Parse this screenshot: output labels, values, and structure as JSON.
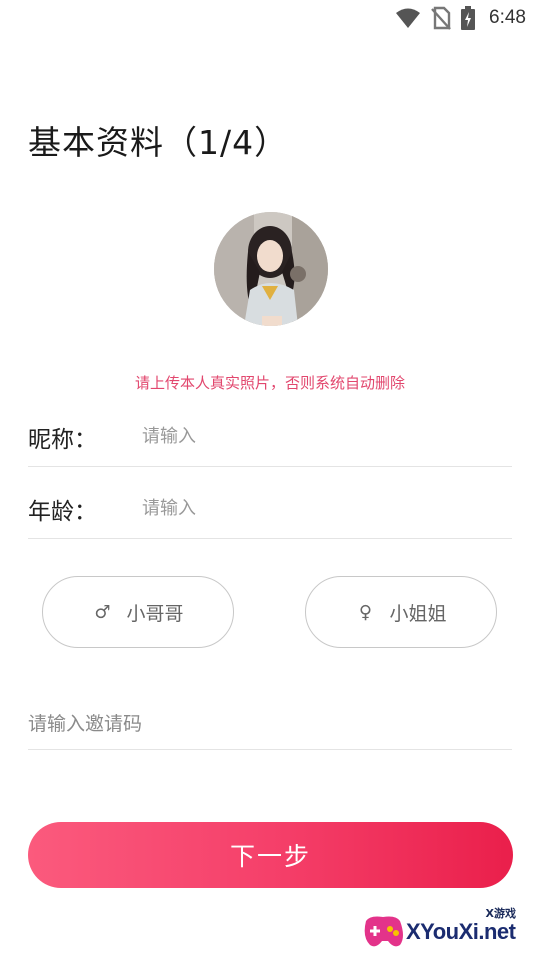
{
  "status_bar": {
    "time": "6:48",
    "icons": [
      "wifi-icon",
      "no-sim-icon",
      "battery-charging-icon"
    ]
  },
  "title": "基本资料（1/4）",
  "avatar": {
    "hint": "请上传本人真实照片，否则系统自动删除"
  },
  "form": {
    "nickname": {
      "label": "昵称：",
      "placeholder": "请输入",
      "value": ""
    },
    "age": {
      "label": "年龄：",
      "placeholder": "请输入",
      "value": ""
    }
  },
  "gender": {
    "male": {
      "icon": "male-icon",
      "symbol": "♂",
      "label": "小哥哥"
    },
    "female": {
      "icon": "female-icon",
      "symbol": "♀",
      "label": "小姐姐"
    }
  },
  "invite": {
    "placeholder": "请输入邀请码",
    "value": ""
  },
  "next_button": {
    "label": "下一步"
  },
  "watermark": {
    "small_text": "X游戏",
    "text": "XYouXi.net"
  },
  "colors": {
    "accent_start": "#fb5a7d",
    "accent_end": "#ea1f4b",
    "hint": "#e2476e"
  }
}
